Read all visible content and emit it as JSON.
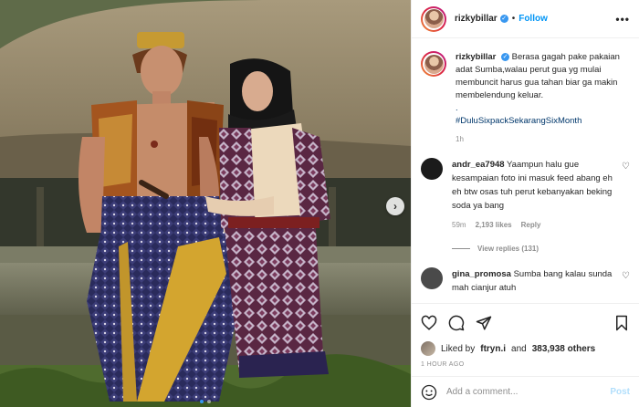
{
  "header": {
    "username": "rizkybillar",
    "separator": "•",
    "follow_label": "Follow",
    "more_label": "•••"
  },
  "caption": {
    "username": "rizkybillar",
    "text": "Berasa gagah pake pakaian adat Sumba,walau perut gua yg mulai membuncit harus gua tahan biar ga makin membelendung keluar.",
    "dot": ".",
    "hashtag": "#DuluSixpackSekarangSixMonth",
    "time": "1h"
  },
  "comments": [
    {
      "username": "andr_ea7948",
      "text": "Yaampun halu gue kesampaian foto ini masuk feed abang eh eh btw osas tuh perut kebanyakan beking soda ya bang",
      "time": "59m",
      "likes": "2,193 likes",
      "reply_label": "Reply",
      "view_replies": "View replies (131)",
      "avatar_color": "#1b1b1b"
    },
    {
      "username": "gina_promosa",
      "text": "Sumba bang kalau sunda mah cianjur atuh",
      "avatar_color": "#4a4a4a"
    }
  ],
  "likes": {
    "prefix": "Liked by",
    "user": "ftryn.i",
    "conjunction": "and",
    "count": "383,938 others"
  },
  "posted": "1 HOUR AGO",
  "add_comment": {
    "placeholder": "Add a comment...",
    "post_label": "Post"
  },
  "icons": [
    "heart-icon",
    "comment-icon",
    "share-icon",
    "bookmark-icon",
    "emoji-icon",
    "verified-icon",
    "chevron-right-icon"
  ],
  "colors": {
    "accent": "#0095f6",
    "verified": "#3897f0",
    "post_disabled": "#b2dffc"
  }
}
